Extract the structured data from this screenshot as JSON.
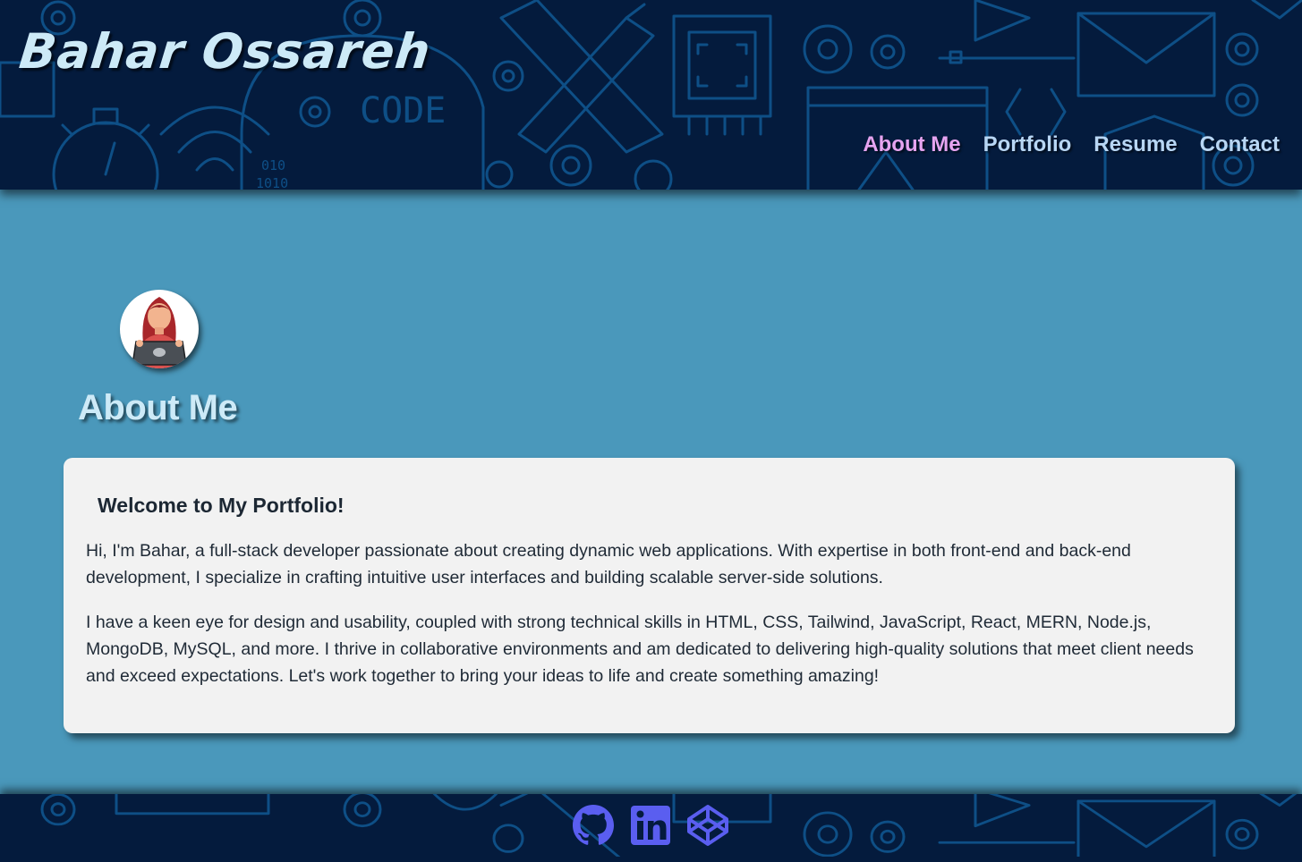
{
  "header": {
    "site_title": "Bahar Ossareh",
    "nav": [
      {
        "label": "About Me",
        "active": true
      },
      {
        "label": "Portfolio",
        "active": false
      },
      {
        "label": "Resume",
        "active": false
      },
      {
        "label": "Contact",
        "active": false
      }
    ],
    "background_pattern_text": [
      "CODE",
      "010",
      "1010"
    ]
  },
  "main": {
    "avatar_icon": "developer-avatar-icon",
    "section_title": "About Me",
    "card": {
      "heading": "Welcome to My Portfolio!",
      "paragraphs": [
        "Hi, I'm Bahar, a full-stack developer passionate about creating dynamic web applications. With expertise in both front-end and back-end development, I specialize in crafting intuitive user interfaces and building scalable server-side solutions.",
        "I have a keen eye for design and usability, coupled with strong technical skills in HTML, CSS, Tailwind, JavaScript, React, MERN, Node.js, MongoDB, MySQL, and more. I thrive in collaborative environments and am dedicated to delivering high-quality solutions that meet client needs and exceed expectations. Let's work together to bring your ideas to life and create something amazing!"
      ]
    }
  },
  "footer": {
    "social_links": [
      {
        "icon": "github-icon"
      },
      {
        "icon": "linkedin-icon"
      },
      {
        "icon": "codepen-icon"
      }
    ]
  },
  "colors": {
    "header_bg": "#041b3d",
    "page_bg": "#4a98bb",
    "nav_link": "#b8d6f4",
    "nav_active": "#e6a4f0",
    "title": "#cdeaf7",
    "card_bg": "#f2f2f2",
    "social_icon": "#5a5ef0"
  }
}
